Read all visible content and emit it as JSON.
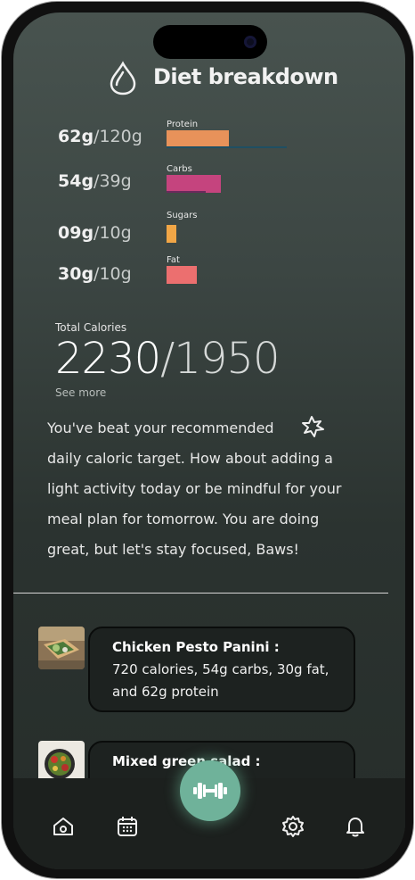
{
  "header": {
    "title": "Diet breakdown",
    "icon": "drop-icon"
  },
  "nutrients": [
    {
      "amount": "62g",
      "target": "/120g",
      "label": "Protein",
      "color": "#e8925a",
      "progress": 0.52
    },
    {
      "amount": "54g",
      "target": "/39g",
      "label": "Carbs",
      "color": "#c5447e",
      "progress": 1.38
    },
    {
      "amount": "09g",
      "target": "/10g",
      "label": "Sugars",
      "color": "#f1a646",
      "progress": 0.9
    },
    {
      "amount": "30g",
      "target": "/10g",
      "label": "Fat",
      "color": "#ec6f6f",
      "progress": 3.0
    }
  ],
  "total": {
    "label": "Total Calories",
    "value": "2230",
    "target": "/1950",
    "see_more": "See more"
  },
  "message": {
    "line1": "You've beat your recommended",
    "line2": "daily caloric target. How about adding a",
    "line3": "light activity today or be mindful for your",
    "line4": "meal plan for tomorrow.  You are doing",
    "line5": "great, but let's stay focused, Baws!"
  },
  "meals": [
    {
      "name": "Chicken Pesto Panini :",
      "description": "720 calories, 54g carbs, 30g fat, and 62g protein"
    },
    {
      "name": "Mixed green salad :",
      "description": ""
    }
  ],
  "nav": {
    "items": [
      "home-icon",
      "calendar-icon",
      "dumbbell-icon",
      "gear-icon",
      "bell-icon"
    ],
    "accent": "#6fb29a"
  }
}
